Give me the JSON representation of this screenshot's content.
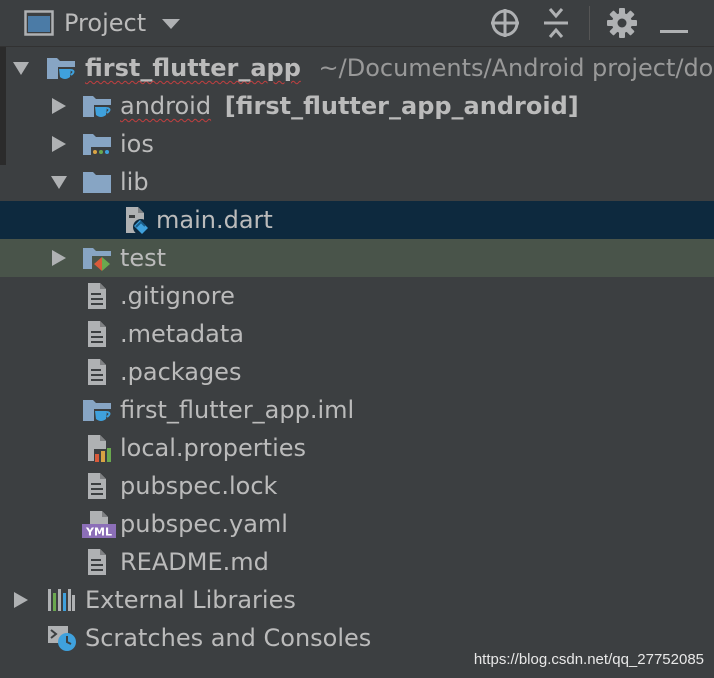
{
  "toolbar": {
    "title": "Project",
    "icons": [
      "window-icon",
      "dropdown-icon",
      "locate-icon",
      "collapse-all-icon",
      "gear-icon",
      "minimize-icon"
    ]
  },
  "tree": {
    "root": {
      "name": "first_flutter_app",
      "path": "~/Documents/Android project/do"
    },
    "android": {
      "name": "android",
      "module": "[first_flutter_app_android]"
    },
    "ios": {
      "name": "ios"
    },
    "lib": {
      "name": "lib"
    },
    "main_dart": {
      "name": "main.dart"
    },
    "test": {
      "name": "test"
    },
    "gitignore": {
      "name": ".gitignore"
    },
    "metadata": {
      "name": ".metadata"
    },
    "packages": {
      "name": ".packages"
    },
    "iml": {
      "name": "first_flutter_app.iml"
    },
    "local_properties": {
      "name": "local.properties"
    },
    "pubspec_lock": {
      "name": "pubspec.lock"
    },
    "pubspec_yaml": {
      "name": "pubspec.yaml",
      "icon_text": "YML"
    },
    "readme": {
      "name": "README.md"
    },
    "external_libraries": {
      "name": "External Libraries"
    },
    "scratches": {
      "name": "Scratches and Consoles"
    }
  },
  "watermark": "https://blog.csdn.net/qq_27752085",
  "colors": {
    "background": "#3c3f41",
    "selected_row": "#0d293e",
    "highlight_row": "#49544a",
    "text": "#bbbbbb",
    "folder_icon": "#87a5c4",
    "flutter_blue": "#3fa1dd"
  }
}
